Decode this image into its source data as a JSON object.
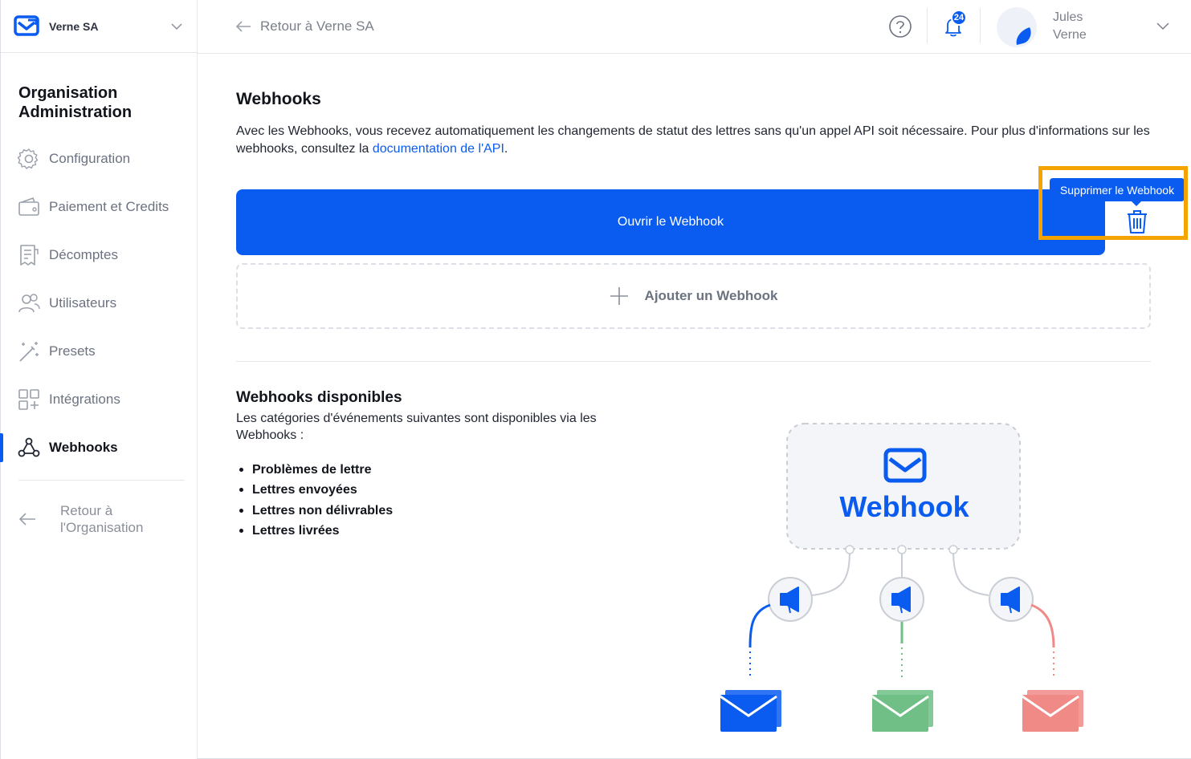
{
  "org_switcher": {
    "name": "Verne SA"
  },
  "sidebar": {
    "title": "Organisation Administration",
    "items": [
      {
        "label": "Configuration",
        "icon": "gear-icon"
      },
      {
        "label": "Paiement et Credits",
        "icon": "wallet-icon"
      },
      {
        "label": "Décomptes",
        "icon": "invoice-icon"
      },
      {
        "label": "Utilisateurs",
        "icon": "users-icon"
      },
      {
        "label": "Presets",
        "icon": "magic-wand-icon"
      },
      {
        "label": "Intégrations",
        "icon": "apps-grid-icon"
      },
      {
        "label": "Webhooks",
        "icon": "webhook-icon",
        "active": true
      }
    ],
    "back_label": "Retour à l'Organisation"
  },
  "topbar": {
    "back_label": "Retour à Verne SA",
    "notification_count": "24",
    "user_first": "Jules",
    "user_last": "Verne"
  },
  "main": {
    "title": "Webhooks",
    "intro_text": "Avec les Webhooks, vous recevez automatiquement les changements de statut des lettres sans qu'un appel API soit nécessaire. Pour plus d'informations sur les webhooks, consultez la ",
    "intro_link": "documentation de l'API",
    "intro_end": ".",
    "open_button": "Ouvrir le Webhook",
    "delete_tooltip": "Supprimer le Webhook",
    "add_button": "Ajouter un Webhook",
    "available_title": "Webhooks disponibles",
    "available_desc": "Les catégories d'événements suivantes sont disponibles via les Webhooks :",
    "categories": [
      "Problèmes de lettre",
      "Lettres envoyées",
      "Lettres non délivrables",
      "Lettres livrées"
    ],
    "illustration_label": "Webhook"
  },
  "colors": {
    "accent": "#0A5CF0",
    "highlight": "#F5A300",
    "green": "#6FBF86",
    "red": "#F08A87"
  }
}
